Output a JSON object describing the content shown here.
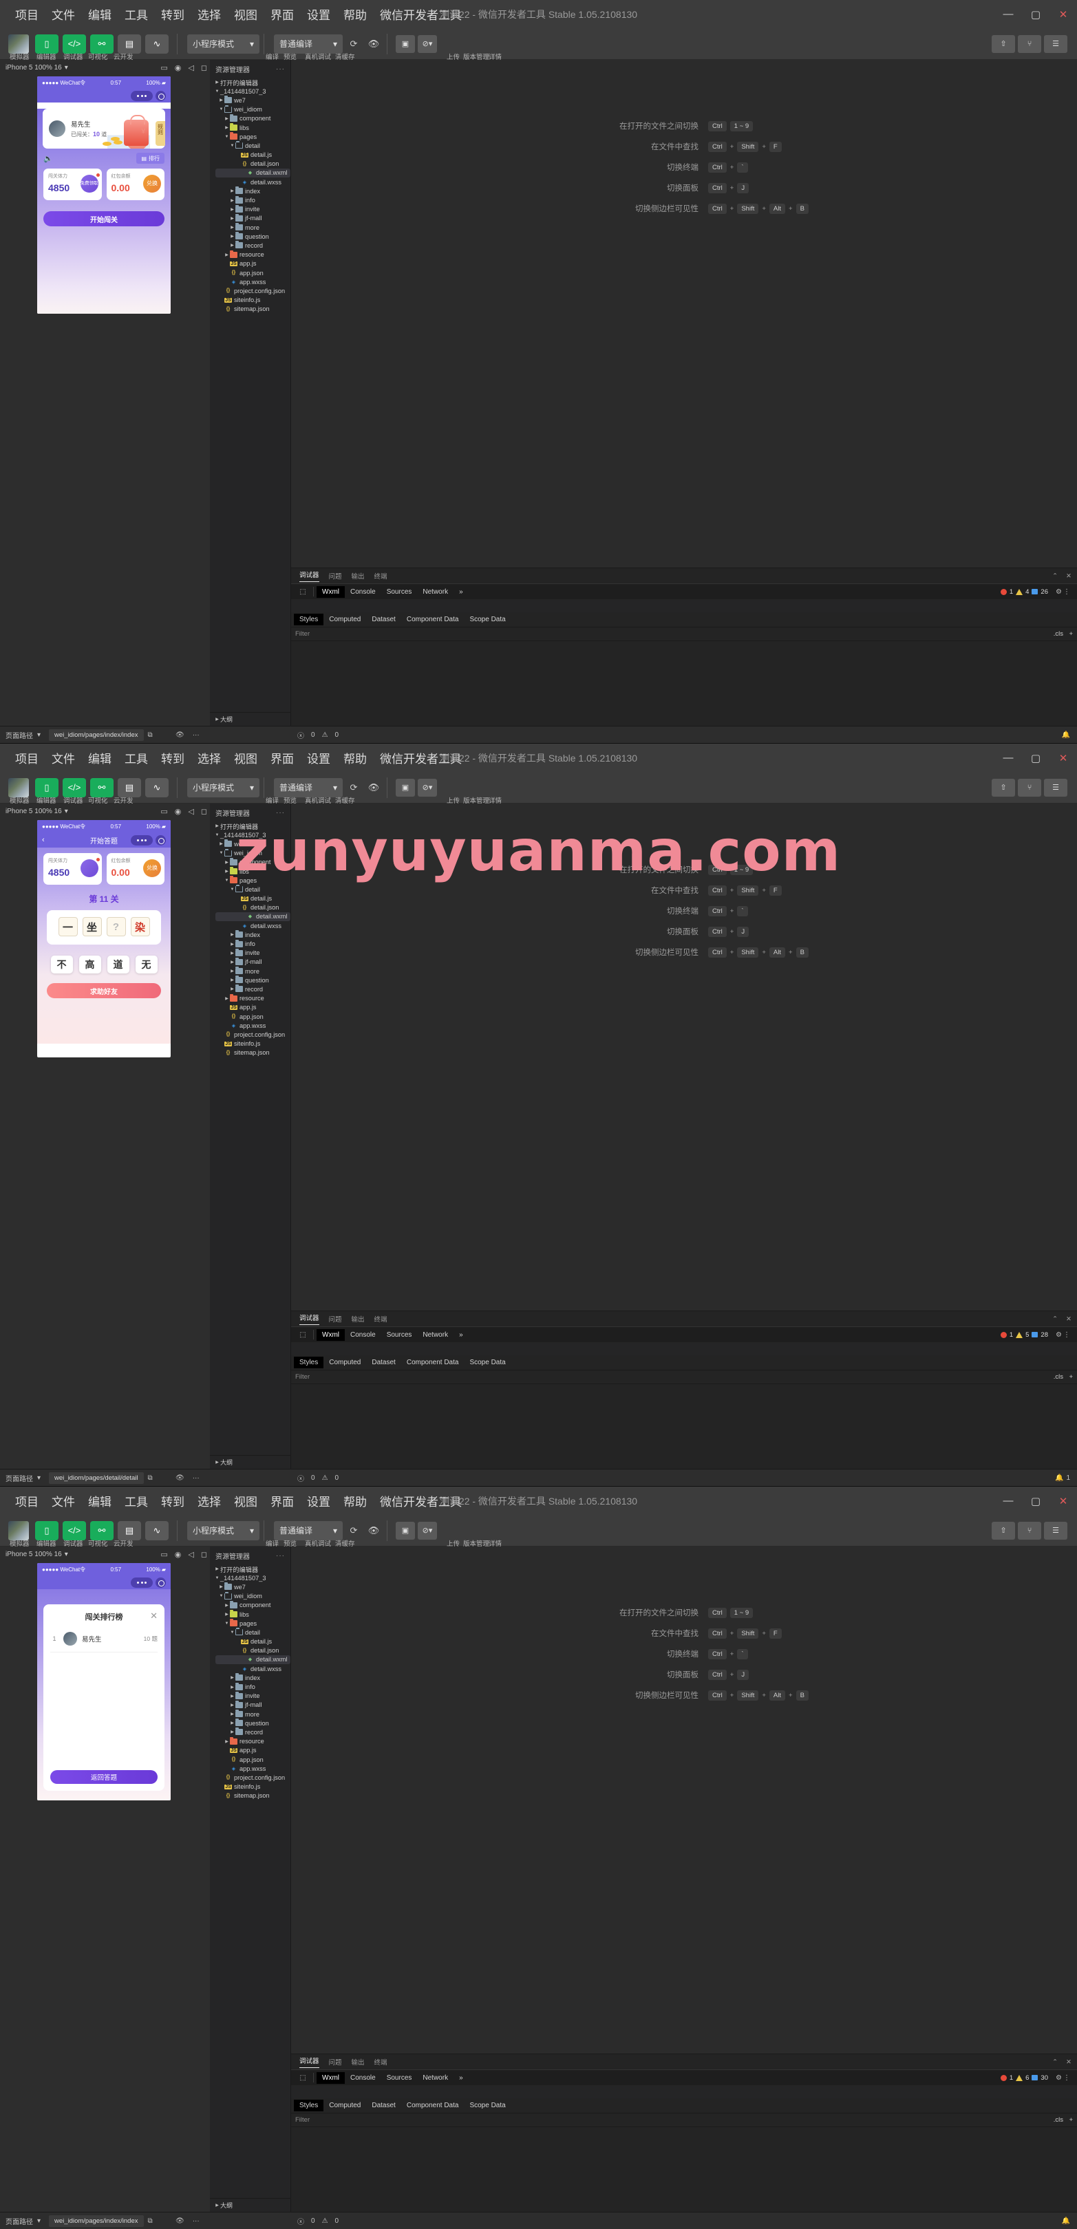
{
  "window": {
    "title": "测试22 - 微信开发者工具 Stable 1.05.2108130",
    "menu": [
      "项目",
      "文件",
      "编辑",
      "工具",
      "转到",
      "选择",
      "视图",
      "界面",
      "设置",
      "帮助",
      "微信开发者工具"
    ],
    "controls": {
      "minimize": "—",
      "maximize": "▢",
      "close": "✕"
    }
  },
  "toolbar": {
    "buttons": [
      {
        "icon": "phone-icon",
        "label": "模拟器"
      },
      {
        "icon": "code-icon",
        "label": "编辑器"
      },
      {
        "icon": "debug-icon",
        "label": "调试器"
      },
      {
        "icon": "visual-icon",
        "label": "可视化"
      },
      {
        "icon": "cloud-icon",
        "label": "云开发"
      }
    ],
    "mode_select": "小程序模式",
    "compile_select": "普通编译",
    "actions": [
      {
        "icon": "compile-icon",
        "label": "编译"
      },
      {
        "icon": "preview-icon",
        "label": "预览"
      },
      {
        "icon": "realdebug-icon",
        "label": "真机调试"
      },
      {
        "icon": "clearcache-icon",
        "label": "清缓存"
      }
    ],
    "right": [
      {
        "icon": "upload-icon",
        "label": "上传"
      },
      {
        "icon": "version-icon",
        "label": "版本管理"
      },
      {
        "icon": "detail-icon",
        "label": "详情"
      }
    ]
  },
  "simulator": {
    "device": "iPhone 5 100% 16",
    "status_time": "0:57",
    "carrier": "●●●●● WeChat令",
    "battery": "100%",
    "page1": {
      "user_name": "易先生",
      "progress_label": "已闯关：",
      "progress_value": "10",
      "progress_unit": "道",
      "rule_tab": "规则",
      "rank_button": "排行",
      "card1": {
        "label": "闯关体力",
        "value": "4850",
        "button": "免费领取"
      },
      "card2": {
        "label": "红包余额",
        "value": "0.00",
        "button": "兑换"
      },
      "start_button": "开始闯关"
    },
    "page2": {
      "nav_title": "开始答题",
      "level": "第 11 关",
      "tiles": [
        "一",
        "坐",
        "?",
        "染"
      ],
      "answers": [
        "不",
        "高",
        "道",
        "无"
      ],
      "friend_button": "求助好友",
      "card1": {
        "label": "闯关体力",
        "value": "4850"
      },
      "card2": {
        "label": "红包余额",
        "value": "0.00",
        "button": "兑换"
      }
    },
    "page3": {
      "modal_title": "闯关排行榜",
      "rows": [
        {
          "rank": "1",
          "name": "易先生",
          "score": "10 题"
        }
      ],
      "back_button": "返回答题"
    }
  },
  "explorer": {
    "title": "资源管理器",
    "open_editors": "打开的编辑器",
    "project": "_1414481507_3",
    "outline": "大纲",
    "tree": [
      {
        "label": "we7",
        "type": "folder",
        "indent": 1,
        "arrow": "▸"
      },
      {
        "label": "wei_idiom",
        "type": "folder-open",
        "indent": 1,
        "arrow": "▾"
      },
      {
        "label": "component",
        "type": "folder",
        "indent": 2,
        "arrow": "▸"
      },
      {
        "label": "libs",
        "type": "folder-yellow",
        "indent": 2,
        "arrow": "▸"
      },
      {
        "label": "pages",
        "type": "folder-red",
        "indent": 2,
        "arrow": "▾"
      },
      {
        "label": "detail",
        "type": "folder-open",
        "indent": 3,
        "arrow": "▾"
      },
      {
        "label": "detail.js",
        "type": "js",
        "indent": 4,
        "arrow": ""
      },
      {
        "label": "detail.json",
        "type": "json",
        "indent": 4,
        "arrow": ""
      },
      {
        "label": "detail.wxml",
        "type": "wxml",
        "indent": 4,
        "arrow": "",
        "selected": true
      },
      {
        "label": "detail.wxss",
        "type": "wxss",
        "indent": 4,
        "arrow": ""
      },
      {
        "label": "index",
        "type": "folder",
        "indent": 3,
        "arrow": "▸"
      },
      {
        "label": "info",
        "type": "folder",
        "indent": 3,
        "arrow": "▸"
      },
      {
        "label": "invite",
        "type": "folder",
        "indent": 3,
        "arrow": "▸"
      },
      {
        "label": "jf-mall",
        "type": "folder",
        "indent": 3,
        "arrow": "▸"
      },
      {
        "label": "more",
        "type": "folder",
        "indent": 3,
        "arrow": "▸"
      },
      {
        "label": "question",
        "type": "folder",
        "indent": 3,
        "arrow": "▸"
      },
      {
        "label": "record",
        "type": "folder",
        "indent": 3,
        "arrow": "▸"
      },
      {
        "label": "resource",
        "type": "folder-orange",
        "indent": 2,
        "arrow": "▸"
      },
      {
        "label": "app.js",
        "type": "js",
        "indent": 2,
        "arrow": ""
      },
      {
        "label": "app.json",
        "type": "json",
        "indent": 2,
        "arrow": ""
      },
      {
        "label": "app.wxss",
        "type": "wxss",
        "indent": 2,
        "arrow": ""
      },
      {
        "label": "project.config.json",
        "type": "json",
        "indent": 1,
        "arrow": ""
      },
      {
        "label": "siteinfo.js",
        "type": "js",
        "indent": 1,
        "arrow": ""
      },
      {
        "label": "sitemap.json",
        "type": "json",
        "indent": 1,
        "arrow": ""
      }
    ]
  },
  "shortcuts": [
    {
      "label": "在打开的文件之间切换",
      "keys": [
        "Ctrl",
        "1 ~ 9"
      ],
      "seps": [
        ""
      ]
    },
    {
      "label": "在文件中查找",
      "keys": [
        "Ctrl",
        "Shift",
        "F"
      ],
      "seps": [
        "+",
        "+"
      ]
    },
    {
      "label": "切换终端",
      "keys": [
        "Ctrl",
        "`"
      ],
      "seps": [
        "+"
      ]
    },
    {
      "label": "切换面板",
      "keys": [
        "Ctrl",
        "J"
      ],
      "seps": [
        "+"
      ]
    },
    {
      "label": "切换侧边栏可见性",
      "keys": [
        "Ctrl",
        "Shift",
        "Alt",
        "B"
      ],
      "seps": [
        "+",
        "+",
        "+"
      ]
    }
  ],
  "devtools": {
    "panel_tabs": [
      "调试器",
      "问题",
      "输出",
      "终端"
    ],
    "active_panel_tab": "调试器",
    "dev_tabs": [
      "Wxml",
      "Console",
      "Sources",
      "Network"
    ],
    "active_dev_tab": "Wxml",
    "more": "»",
    "style_tabs": [
      "Styles",
      "Computed",
      "Dataset",
      "Component Data",
      "Scope Data"
    ],
    "active_style_tab": "Styles",
    "filter_placeholder": "Filter",
    "cls_label": ".cls",
    "plus_label": "+"
  },
  "statusbar": {
    "path_label": "页面路径",
    "errors": "0",
    "warnings": "0",
    "bell": "1"
  },
  "windows": [
    {
      "counters": {
        "errors": "1",
        "warnings": "4",
        "messages": "26"
      },
      "path": "wei_idiom/pages/index/index",
      "bell": ""
    },
    {
      "counters": {
        "errors": "1",
        "warnings": "5",
        "messages": "28"
      },
      "path": "wei_idiom/pages/detail/detail",
      "bell": "1"
    },
    {
      "counters": {
        "errors": "1",
        "warnings": "6",
        "messages": "30"
      },
      "path": "wei_idiom/pages/index/index",
      "bell": ""
    }
  ],
  "watermark": "zunyuyuanma.com"
}
